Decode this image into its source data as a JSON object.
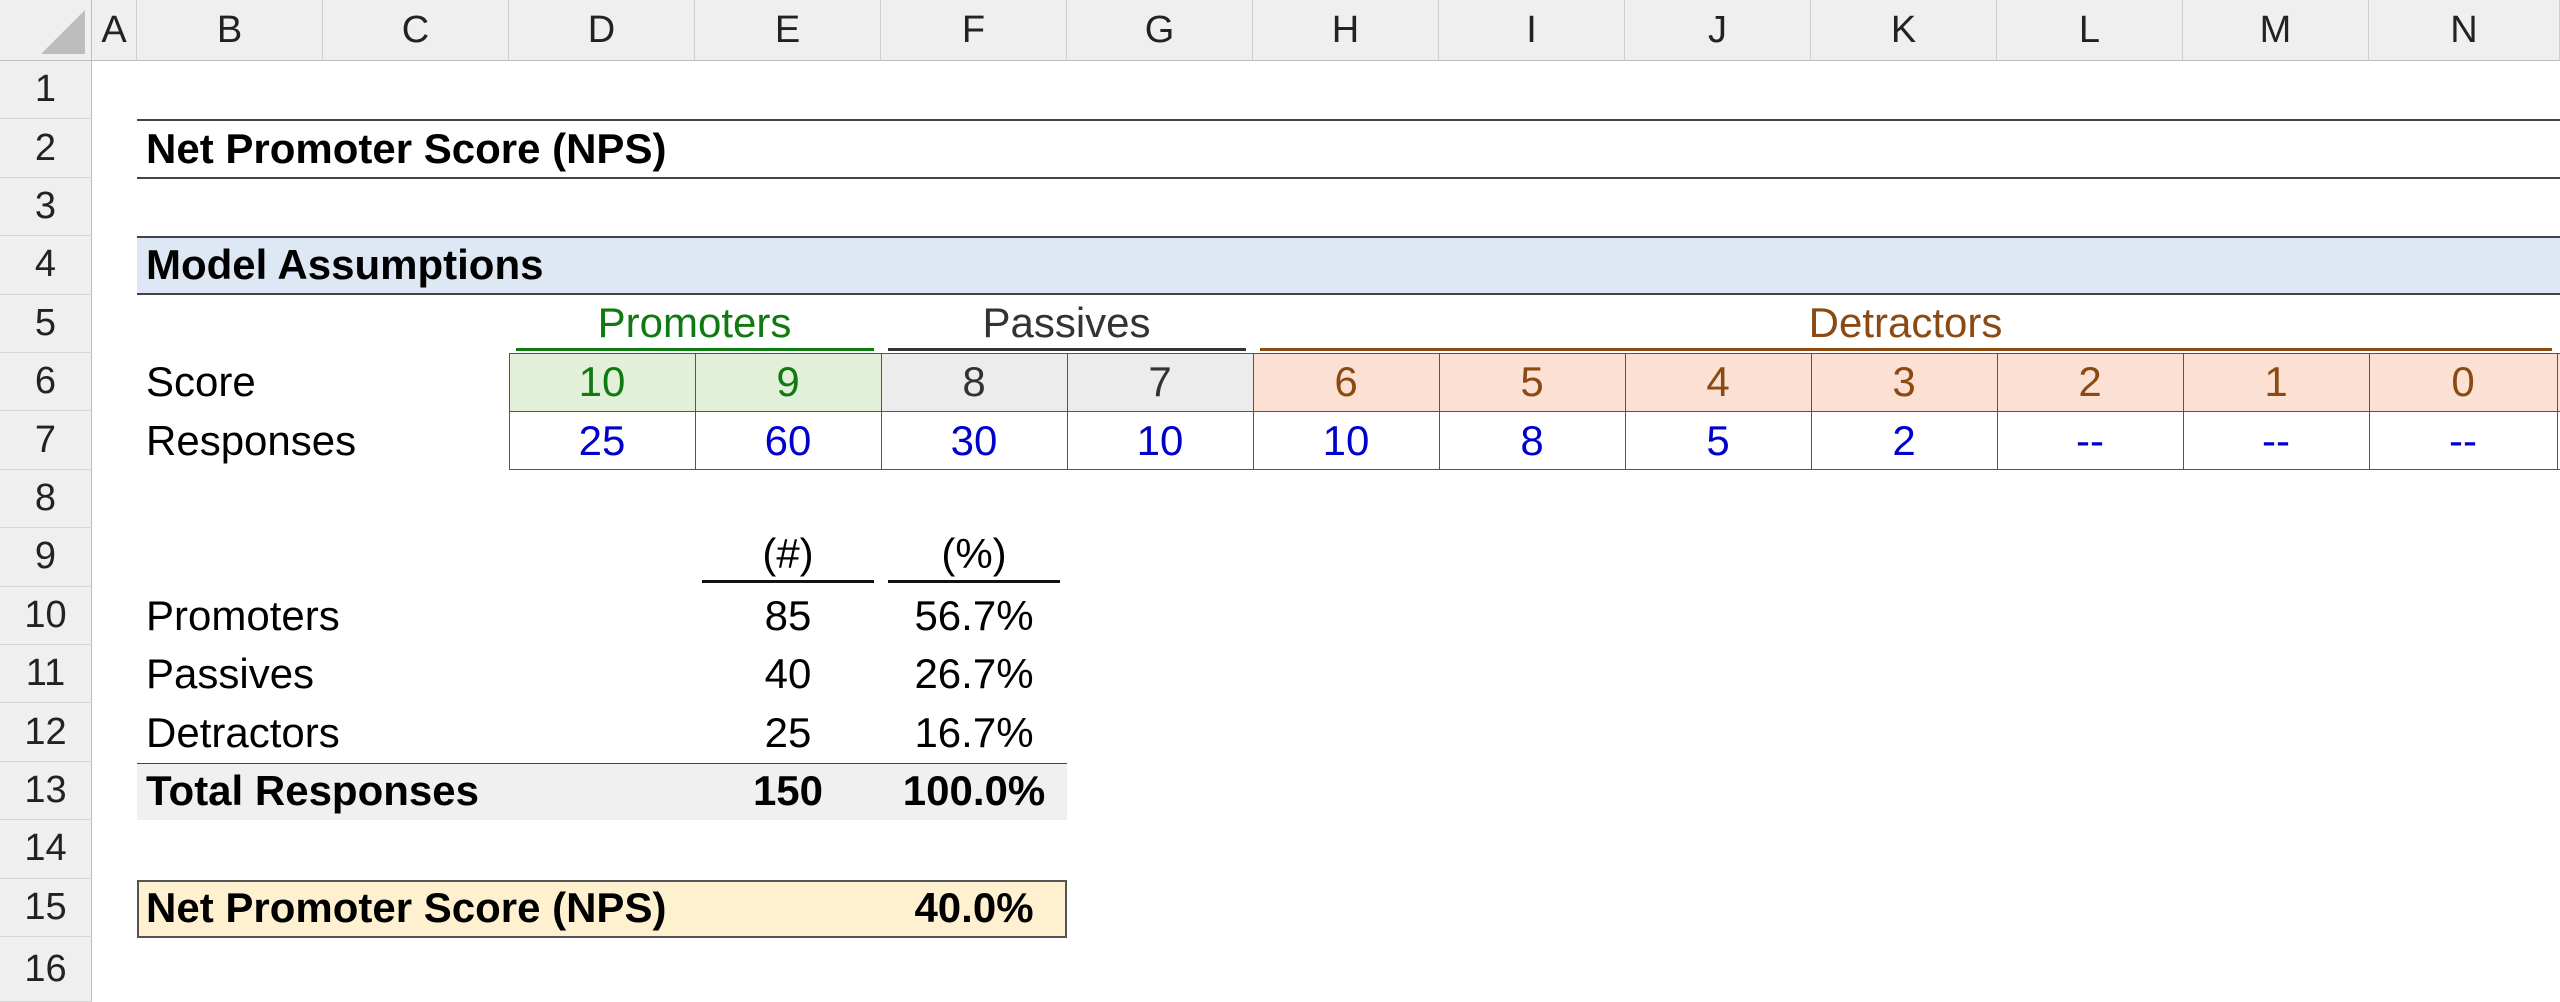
{
  "columns": [
    "A",
    "B",
    "C",
    "D",
    "E",
    "F",
    "G",
    "H",
    "I",
    "J",
    "K",
    "L",
    "M",
    "N"
  ],
  "rows": [
    "1",
    "2",
    "3",
    "4",
    "5",
    "6",
    "7",
    "8",
    "9",
    "10",
    "11",
    "12",
    "13",
    "14",
    "15",
    "16"
  ],
  "title": "Net Promoter Score (NPS)",
  "section_header": "Model Assumptions",
  "groups": {
    "promoters": "Promoters",
    "passives": "Passives",
    "detractors": "Detractors"
  },
  "row_labels": {
    "score": "Score",
    "responses": "Responses"
  },
  "scores": [
    "10",
    "9",
    "8",
    "7",
    "6",
    "5",
    "4",
    "3",
    "2",
    "1",
    "0"
  ],
  "responses": [
    "25",
    "60",
    "30",
    "10",
    "10",
    "8",
    "5",
    "2",
    "--",
    "--",
    "--"
  ],
  "summary": {
    "count_header": "(#)",
    "pct_header": "(%)",
    "rows": [
      {
        "label": "Promoters",
        "count": "85",
        "pct": "56.7%"
      },
      {
        "label": "Passives",
        "count": "40",
        "pct": "26.7%"
      },
      {
        "label": "Detractors",
        "count": "25",
        "pct": "16.7%"
      }
    ],
    "total": {
      "label": "Total Responses",
      "count": "150",
      "pct": "100.0%"
    }
  },
  "nps": {
    "label": "Net Promoter Score (NPS)",
    "value": "40.0%"
  },
  "colors": {
    "promoter_fill": "#e2f0d9",
    "passive_fill": "#ececec",
    "detractor_fill": "#fbe0d3",
    "section_fill": "#dde8f4",
    "total_fill": "#f0f0f0",
    "nps_fill": "#fff1cf",
    "promoter_text": "#0f7a0f",
    "detractor_text": "#8a4a12",
    "input_text": "#0000cc"
  }
}
